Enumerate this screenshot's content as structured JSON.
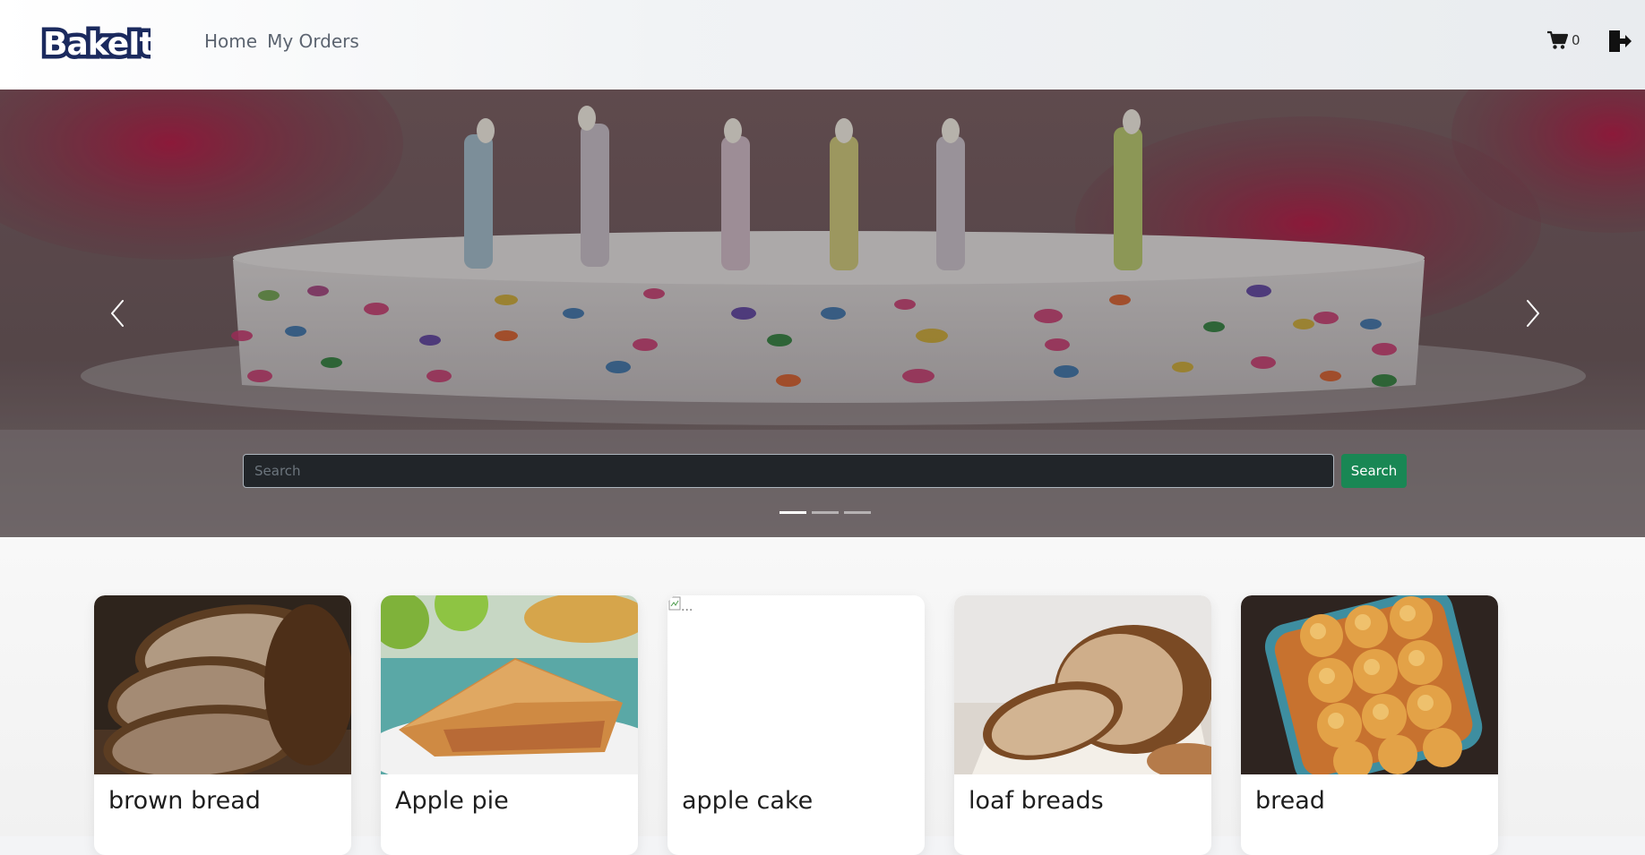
{
  "brand": {
    "name": "BakeIt"
  },
  "nav": {
    "links": [
      {
        "label": "Home"
      },
      {
        "label": "My Orders"
      }
    ],
    "cart_count": "0"
  },
  "hero": {
    "search": {
      "placeholder": "Search",
      "button_label": "Search"
    },
    "slides": 3,
    "active_slide": 1
  },
  "products": [
    {
      "title": "brown bread"
    },
    {
      "title": "Apple pie"
    },
    {
      "title": "apple cake",
      "image_alt": "..."
    },
    {
      "title": "loaf breads"
    },
    {
      "title": "bread"
    }
  ],
  "colors": {
    "search_button": "#198754",
    "logo_outline": "#1b2a5e"
  }
}
